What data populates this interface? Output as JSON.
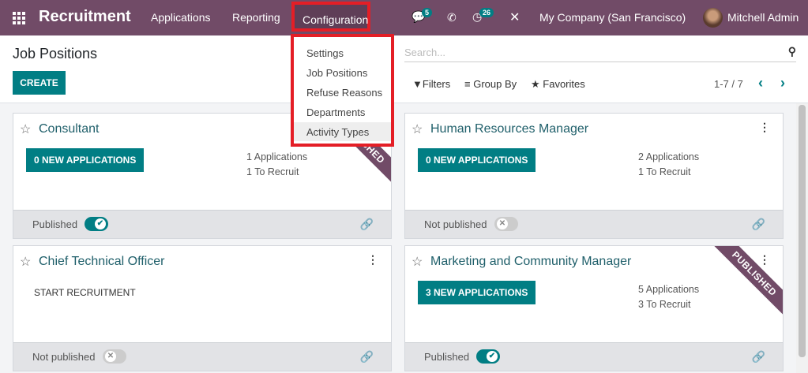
{
  "nav": {
    "brand": "Recruitment",
    "menus": [
      "Applications",
      "Reporting",
      "Configuration"
    ],
    "messages_count": "5",
    "activities_count": "26",
    "company": "My Company (San Francisco)",
    "user": "Mitchell Admin"
  },
  "config_menu": [
    "Settings",
    "Job Positions",
    "Refuse Reasons",
    "Departments",
    "Activity Types"
  ],
  "control": {
    "title": "Job Positions",
    "create": "CREATE",
    "search_placeholder": "Search...",
    "filters": "Filters",
    "group_by": "Group By",
    "favorites": "Favorites",
    "pager": "1-7 / 7"
  },
  "cards": [
    {
      "name": "Consultant",
      "button": "0 NEW APPLICATIONS",
      "applications": "1 Applications",
      "to_recruit": "1 To Recruit",
      "status": "Published",
      "published": true,
      "ribbon": "PUBLISHED"
    },
    {
      "name": "Human Resources Manager",
      "button": "0 NEW APPLICATIONS",
      "applications": "2 Applications",
      "to_recruit": "1 To Recruit",
      "status": "Not published",
      "published": false
    },
    {
      "name": "Chief Technical Officer",
      "button": "START RECRUITMENT",
      "status": "Not published",
      "published": false
    },
    {
      "name": "Marketing and Community Manager",
      "button": "3 NEW APPLICATIONS",
      "applications": "5 Applications",
      "to_recruit": "3 To Recruit",
      "status": "Published",
      "published": true,
      "ribbon": "PUBLISHED"
    }
  ]
}
